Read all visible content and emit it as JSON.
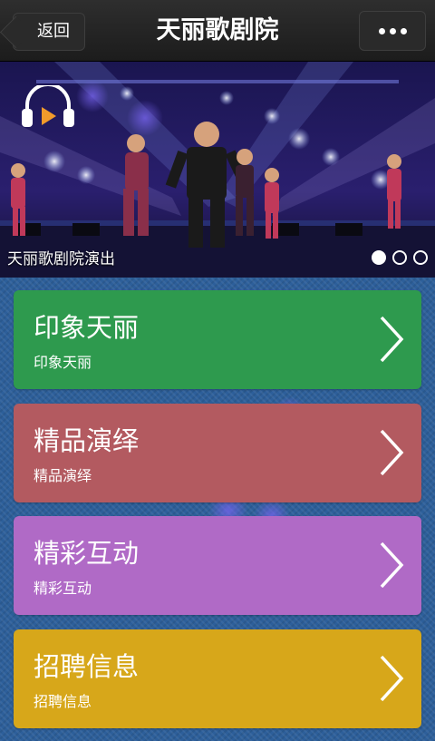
{
  "navbar": {
    "back_label": "返回",
    "title": "天丽歌剧院",
    "more_icon": "more-dots-icon"
  },
  "banner": {
    "caption": "天丽歌剧院演出",
    "slide_count": 3,
    "active_slide": 1,
    "audio_icon": "headphones-play-icon"
  },
  "menu": [
    {
      "title": "印象天丽",
      "subtitle": "印象天丽",
      "color": "#2e9a4e"
    },
    {
      "title": "精品演绎",
      "subtitle": "精品演绎",
      "color": "#b35a60"
    },
    {
      "title": "精彩互动",
      "subtitle": "精彩互动",
      "color": "#b06ac6"
    },
    {
      "title": "招聘信息",
      "subtitle": "招聘信息",
      "color": "#d7a71a"
    }
  ],
  "colors": {
    "navbar": "#222222",
    "background": "#2d5f9a"
  }
}
